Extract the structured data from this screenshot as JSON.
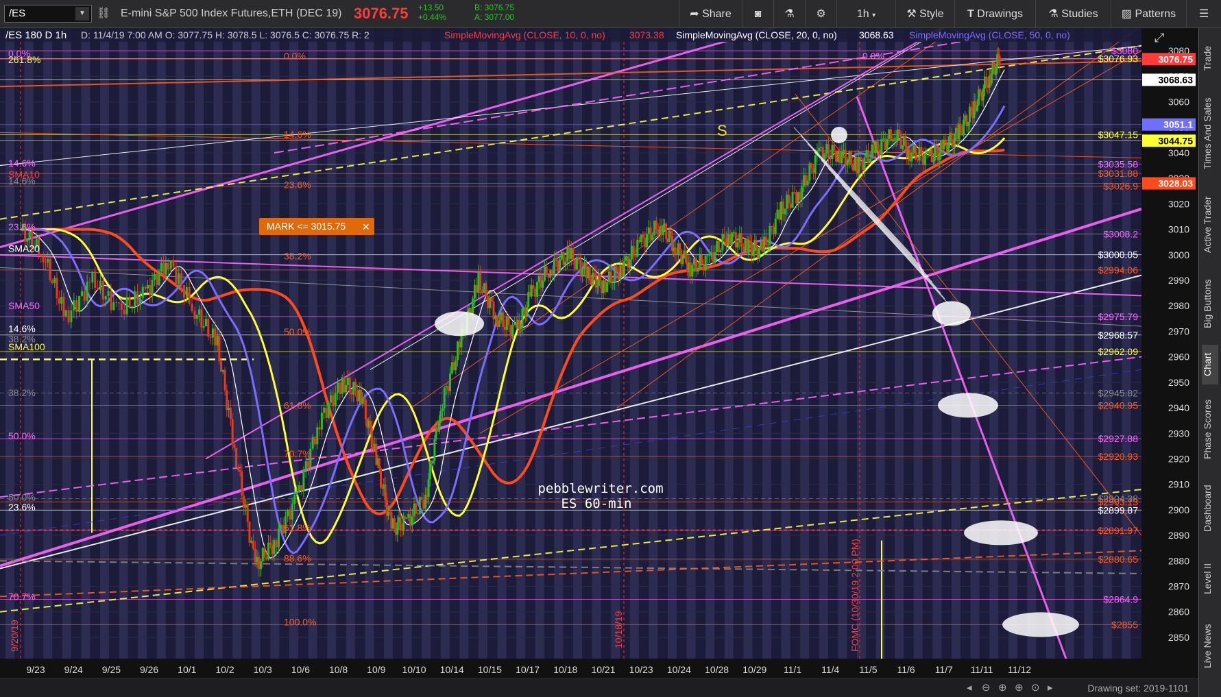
{
  "toolbar": {
    "symbol": "/ES",
    "description": "E-mini S&P 500 Index Futures,ETH (DEC 19)",
    "last": "3076.75",
    "change": "+13.50",
    "change_pct": "+0.44%",
    "bid": "B: 3076.75",
    "ask": "A: 3077.00",
    "share": "Share",
    "interval": "1h",
    "style": "Style",
    "drawings": "Drawings",
    "studies": "Studies",
    "patterns": "Patterns"
  },
  "header": {
    "chart_label": "/ES 180 D 1h",
    "ohlc": "D: 11/4/19 7:00 AM O: 3077.75 H: 3078.5 L: 3076.5 C: 3076.75 R: 2",
    "sma10": "SimpleMovingAvg (CLOSE, 10, 0, no)",
    "sma10_val": "3073.38",
    "sma20": "SimpleMovingAvg (CLOSE, 20, 0, no)",
    "sma20_val": "3068.63",
    "sma50": "SimpleMovingAvg (CLOSE, 50, 0, no)"
  },
  "sidebar": [
    "Trade",
    "Times And Sales",
    "Active Trader",
    "Big Buttons",
    "Chart",
    "Phase Scores",
    "Dashboard",
    "Level II",
    "Live News"
  ],
  "status": {
    "drawing_set": "Drawing set: 2019-1101"
  },
  "colors": {
    "bg": "#1c1c3a",
    "band": "#3a3a66",
    "candle_up": "#22c022",
    "candle_down": "#e83a1a",
    "sma10": "#ffffff",
    "sma20": "#ffff33",
    "sma50": "#7c6cff",
    "sma100": "#ff4a1c",
    "magenta": "#ff66ff",
    "orange": "#ff5a1e",
    "yellow": "#ffff44"
  },
  "annotations": {
    "watermark1": "pebblewriter.com",
    "watermark2": "ES 60-min",
    "mark_tag": "MARK <= 3015.75",
    "s_label": "S",
    "vline_1018": "10/18/19",
    "vline_0920": "9/20/19",
    "vline_fomc": "FOMC (10/30/19 2:00 PM)"
  },
  "chart_data": {
    "type": "candlestick",
    "ylim": [
      2843,
      3083
    ],
    "y_ticks": [
      2850,
      2860,
      2870,
      2880,
      2890,
      2900,
      2910,
      2920,
      2930,
      2940,
      2950,
      2960,
      2970,
      2980,
      2990,
      3000,
      3010,
      3020,
      3030,
      3040,
      3050,
      3060,
      3070,
      3080
    ],
    "x_labels": [
      "9/23",
      "9/24",
      "9/25",
      "9/26",
      "10/1",
      "10/2",
      "10/3",
      "10/6",
      "10/8",
      "10/9",
      "10/10",
      "10/14",
      "10/15",
      "10/17",
      "10/18",
      "10/21",
      "10/23",
      "10/24",
      "10/28",
      "10/29",
      "11/1",
      "11/4",
      "11/5",
      "11/6",
      "11/7",
      "11/11",
      "11/12"
    ],
    "price_path": [
      [
        0,
        3010
      ],
      [
        0.6,
        3000
      ],
      [
        1.2,
        2975
      ],
      [
        1.9,
        2990
      ],
      [
        2.6,
        2978
      ],
      [
        3.3,
        2985
      ],
      [
        3.9,
        2998
      ],
      [
        4.6,
        2978
      ],
      [
        5.2,
        2965
      ],
      [
        5.7,
        2920
      ],
      [
        6.2,
        2878
      ],
      [
        6.7,
        2887
      ],
      [
        7.3,
        2905
      ],
      [
        7.9,
        2935
      ],
      [
        8.5,
        2950
      ],
      [
        9.0,
        2945
      ],
      [
        9.4,
        2920
      ],
      [
        9.8,
        2893
      ],
      [
        10.2,
        2895
      ],
      [
        10.7,
        2905
      ],
      [
        11.1,
        2940
      ],
      [
        11.6,
        2965
      ],
      [
        12.1,
        2990
      ],
      [
        12.6,
        2975
      ],
      [
        13.1,
        2970
      ],
      [
        13.5,
        2985
      ],
      [
        14.0,
        2995
      ],
      [
        14.5,
        3000
      ],
      [
        15.0,
        2992
      ],
      [
        15.4,
        2988
      ],
      [
        15.9,
        2995
      ],
      [
        16.4,
        3005
      ],
      [
        16.9,
        3012
      ],
      [
        17.3,
        3003
      ],
      [
        17.7,
        2995
      ],
      [
        18.2,
        2998
      ],
      [
        18.7,
        3008
      ],
      [
        19.2,
        3003
      ],
      [
        19.6,
        3002
      ],
      [
        20.1,
        3018
      ],
      [
        20.6,
        3025
      ],
      [
        21.1,
        3040
      ],
      [
        21.6,
        3040
      ],
      [
        22.1,
        3035
      ],
      [
        22.6,
        3041
      ],
      [
        23.1,
        3048
      ],
      [
        23.5,
        3040
      ],
      [
        24.0,
        3038
      ],
      [
        24.4,
        3042
      ],
      [
        24.8,
        3048
      ],
      [
        25.2,
        3058
      ],
      [
        25.6,
        3070
      ],
      [
        25.9,
        3078
      ]
    ],
    "right_axis_labels": [
      {
        "value": 3080,
        "label": "$3080",
        "color": "#ff66ff"
      },
      {
        "value": 3076.93,
        "label": "$3076.93",
        "color": "#ffff44"
      },
      {
        "value": 3076.75,
        "label": "3076.75",
        "color": "#ff3b3b",
        "box": true
      },
      {
        "value": 3068.63,
        "label": "3068.63",
        "color": "#ffffff",
        "box": true
      },
      {
        "value": 3051.1,
        "label": "3051.1",
        "color": "#6f6fff",
        "box": true
      },
      {
        "value": 3047.15,
        "label": "$3047.15",
        "color": "#ffff44"
      },
      {
        "value": 3044.75,
        "label": "3044.75",
        "color": "#ffff33",
        "box": true
      },
      {
        "value": 3035.58,
        "label": "$3035.58",
        "color": "#ff66ff"
      },
      {
        "value": 3031.88,
        "label": "$3031.88",
        "color": "#ff5a1e"
      },
      {
        "value": 3028.03,
        "label": "3028.03",
        "color": "#ff4a1c",
        "box": true
      },
      {
        "value": 3026.9,
        "label": "$3026.9",
        "color": "#ff5a1e"
      },
      {
        "value": 3008.2,
        "label": "$3008.2",
        "color": "#ff66ff"
      },
      {
        "value": 3000.05,
        "label": "$3000.05",
        "color": "#ffffff"
      },
      {
        "value": 2994.06,
        "label": "$2994.06",
        "color": "#ff5a1e"
      },
      {
        "value": 2975.79,
        "label": "$2975.79",
        "color": "#ff66ff"
      },
      {
        "value": 2968.57,
        "label": "$2968.57",
        "color": "#ffffff"
      },
      {
        "value": 2962.09,
        "label": "$2962.09",
        "color": "#ffff44"
      },
      {
        "value": 2945.82,
        "label": "$2945.82",
        "color": "#888888"
      },
      {
        "value": 2940.95,
        "label": "$2940.95",
        "color": "#ff5a1e"
      },
      {
        "value": 2927.88,
        "label": "$2927.88",
        "color": "#ff66ff"
      },
      {
        "value": 2920.93,
        "label": "$2920.93",
        "color": "#ff5a1e"
      },
      {
        "value": 2904.38,
        "label": "$2904.38",
        "color": "#888888"
      },
      {
        "value": 2903.13,
        "label": "$2903.13",
        "color": "#ff5a1e"
      },
      {
        "value": 2899.87,
        "label": "$2899.87",
        "color": "#ffffff"
      },
      {
        "value": 2891.97,
        "label": "$2891.97",
        "color": "#ff5a1e"
      },
      {
        "value": 2880.65,
        "label": "$2880.65",
        "color": "#ff5a1e"
      },
      {
        "value": 2864.9,
        "label": "$2864.9",
        "color": "#ff66ff"
      },
      {
        "value": 2855,
        "label": "$2855",
        "color": "#ff5a1e"
      }
    ],
    "fib_labels": [
      {
        "value": 3079,
        "label": "0.0%",
        "color": "#ff66ff"
      },
      {
        "value": 3078,
        "label": "0.0%",
        "color": "#ff5a1e"
      },
      {
        "value": 3078,
        "label": "0.0%",
        "color": "#ff66ff"
      },
      {
        "value": 3076.5,
        "label": "261.8%",
        "color": "#ffff44"
      },
      {
        "value": 3047.2,
        "label": "14.6%",
        "color": "#ff5a1e"
      },
      {
        "value": 3036,
        "label": "14.6%",
        "color": "#ff66ff"
      },
      {
        "value": 3031.5,
        "label": "SMA10",
        "color": "#ff3b3b"
      },
      {
        "value": 3029,
        "label": "14.6%",
        "color": "#888888"
      },
      {
        "value": 3027.5,
        "label": "23.6%",
        "color": "#ff5a1e"
      },
      {
        "value": 3011,
        "label": "23.6%",
        "color": "#ff66ff"
      },
      {
        "value": 3002.5,
        "label": "SMA20",
        "color": "#ffffff"
      },
      {
        "value": 2999.5,
        "label": "38.2%",
        "color": "#ff5a1e"
      },
      {
        "value": 2980,
        "label": "SMA50",
        "color": "#ff66ff"
      },
      {
        "value": 2971,
        "label": "14.6%",
        "color": "#ffffff"
      },
      {
        "value": 2969.8,
        "label": "50.0%",
        "color": "#ff5a1e"
      },
      {
        "value": 2967,
        "label": "38.2%",
        "color": "#888888"
      },
      {
        "value": 2964,
        "label": "SMA100",
        "color": "#ffff44"
      },
      {
        "value": 2946,
        "label": "38.2%",
        "color": "#888888"
      },
      {
        "value": 2941,
        "label": "61.8%",
        "color": "#ff5a1e"
      },
      {
        "value": 2929,
        "label": "50.0%",
        "color": "#ff66ff"
      },
      {
        "value": 2922,
        "label": "70.7%",
        "color": "#ff5a1e"
      },
      {
        "value": 2905,
        "label": "50.0%",
        "color": "#888888"
      },
      {
        "value": 2901,
        "label": "23.6%",
        "color": "#ffffff"
      },
      {
        "value": 2893,
        "label": "61.8%",
        "color": "#ff5a1e"
      },
      {
        "value": 2881,
        "label": "88.6%",
        "color": "#ff5a1e"
      },
      {
        "value": 2866,
        "label": "70.7%",
        "color": "#ff66ff"
      },
      {
        "value": 2856,
        "label": "100.0%",
        "color": "#ff5a1e"
      }
    ]
  }
}
